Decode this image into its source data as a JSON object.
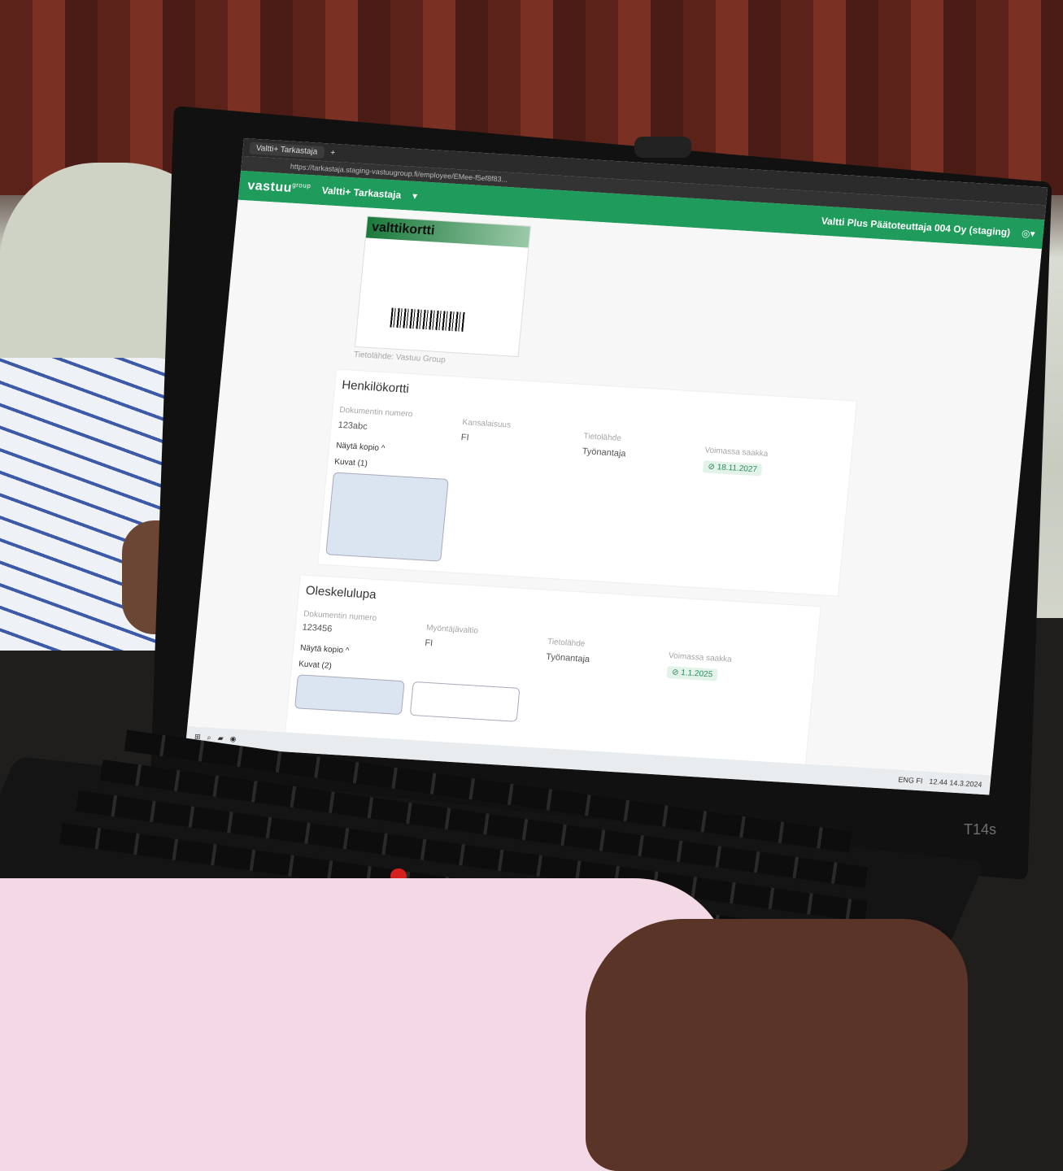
{
  "browser": {
    "tab_title": "Valtti+ Tarkastaja",
    "url": "https://tarkastaja.staging-vastuugroup.fi/employee/EMee-f5ef8f83..."
  },
  "appbar": {
    "brand": "vastuu",
    "brand_suffix": "group",
    "app_name": "Valtti+ Tarkastaja",
    "organization": "Valtti Plus Päätoteuttaja 004 Oy (staging)"
  },
  "valttikortti": {
    "title": "valttikortti",
    "issuer_label": "Tietolähde: Vastuu Group"
  },
  "henkilokortti": {
    "title": "Henkilökortti",
    "doc_number_label": "Dokumentin numero",
    "doc_number": "123abc",
    "nationality_label": "Kansalaisuus",
    "nationality": "FI",
    "source_label": "Tietolähde",
    "source": "Työnantaja",
    "valid_label": "Voimassa saakka",
    "valid_until": "18.11.2027",
    "show_copy": "Näytä kopio ^",
    "images_label": "Kuvat (1)"
  },
  "oleskelulupa": {
    "title": "Oleskelulupa",
    "doc_number_label": "Dokumentin numero",
    "doc_number": "123456",
    "authority_label": "Myöntäjävaltio",
    "authority": "FI",
    "source_label": "Tietolähde",
    "source": "Työnantaja",
    "valid_label": "Voimassa saakka",
    "valid_until": "1.1.2025",
    "show_copy": "Näytä kopio ^",
    "images_label": "Kuvat (2)"
  },
  "taskbar": {
    "lang": "ENG",
    "lang_sub": "FI",
    "time": "12.44",
    "date": "14.3.2024"
  },
  "laptop": {
    "model": "T14s"
  }
}
